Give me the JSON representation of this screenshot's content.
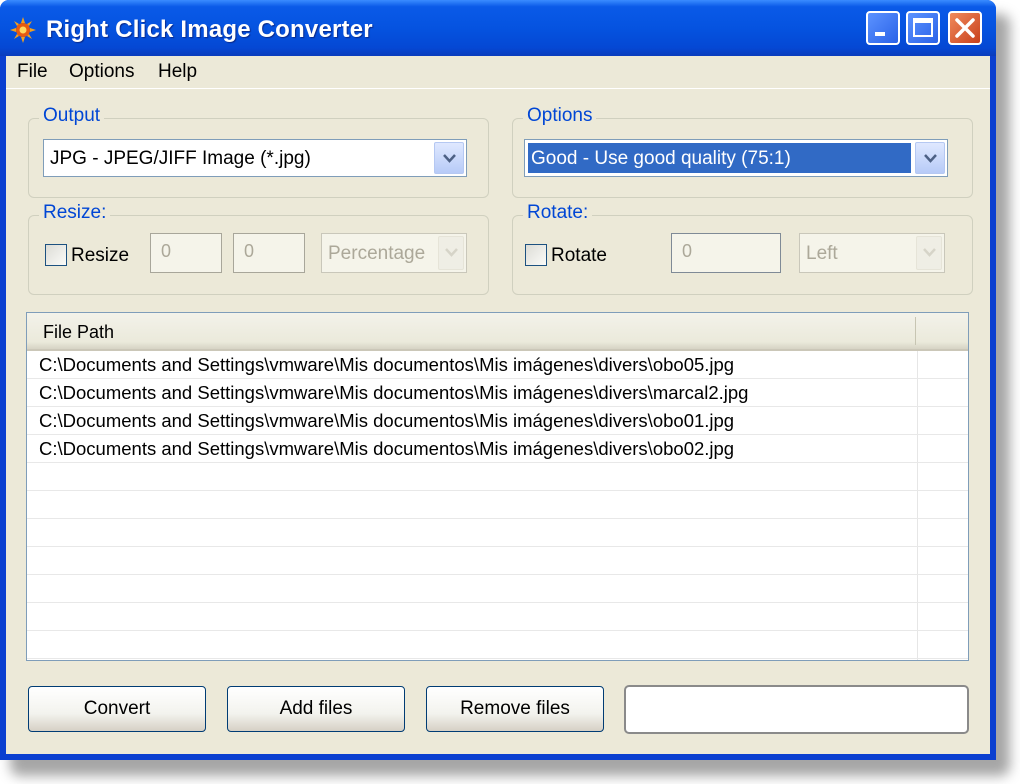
{
  "window": {
    "title": "Right Click Image Converter",
    "app_icon": "gear-sun-icon",
    "controls": {
      "minimize": "minimize-icon",
      "maximize": "maximize-icon",
      "close": "close-icon"
    }
  },
  "menu": {
    "items": [
      {
        "label": "File"
      },
      {
        "label": "Options"
      },
      {
        "label": "Help"
      }
    ]
  },
  "output_group": {
    "label": "Output",
    "format_selected": "JPG - JPEG/JIFF Image (*.jpg)"
  },
  "options_group": {
    "label": "Options",
    "quality_selected": "Good - Use good quality (75:1)"
  },
  "resize_group": {
    "label": "Resize:",
    "checkbox_label": "Resize",
    "checked": false,
    "width_value": "0",
    "height_value": "0",
    "unit_selected": "Percentage"
  },
  "rotate_group": {
    "label": "Rotate:",
    "checkbox_label": "Rotate",
    "checked": false,
    "angle_value": "0",
    "direction_selected": "Left"
  },
  "file_list": {
    "columns": [
      "File Path",
      ""
    ],
    "rows": [
      "C:\\Documents and Settings\\vmware\\Mis documentos\\Mis imágenes\\divers\\obo05.jpg",
      "C:\\Documents and Settings\\vmware\\Mis documentos\\Mis imágenes\\divers\\marcal2.jpg",
      "C:\\Documents and Settings\\vmware\\Mis documentos\\Mis imágenes\\divers\\obo01.jpg",
      "C:\\Documents and Settings\\vmware\\Mis documentos\\Mis imágenes\\divers\\obo02.jpg"
    ]
  },
  "buttons": {
    "convert": "Convert",
    "add_files": "Add files",
    "remove_files": "Remove files"
  },
  "status_text": "",
  "colors": {
    "titlebar": "#0553e0",
    "client_bg": "#ece9d8",
    "group_label": "#0046d5",
    "selection": "#316ac5",
    "close_button": "#c8401c"
  }
}
